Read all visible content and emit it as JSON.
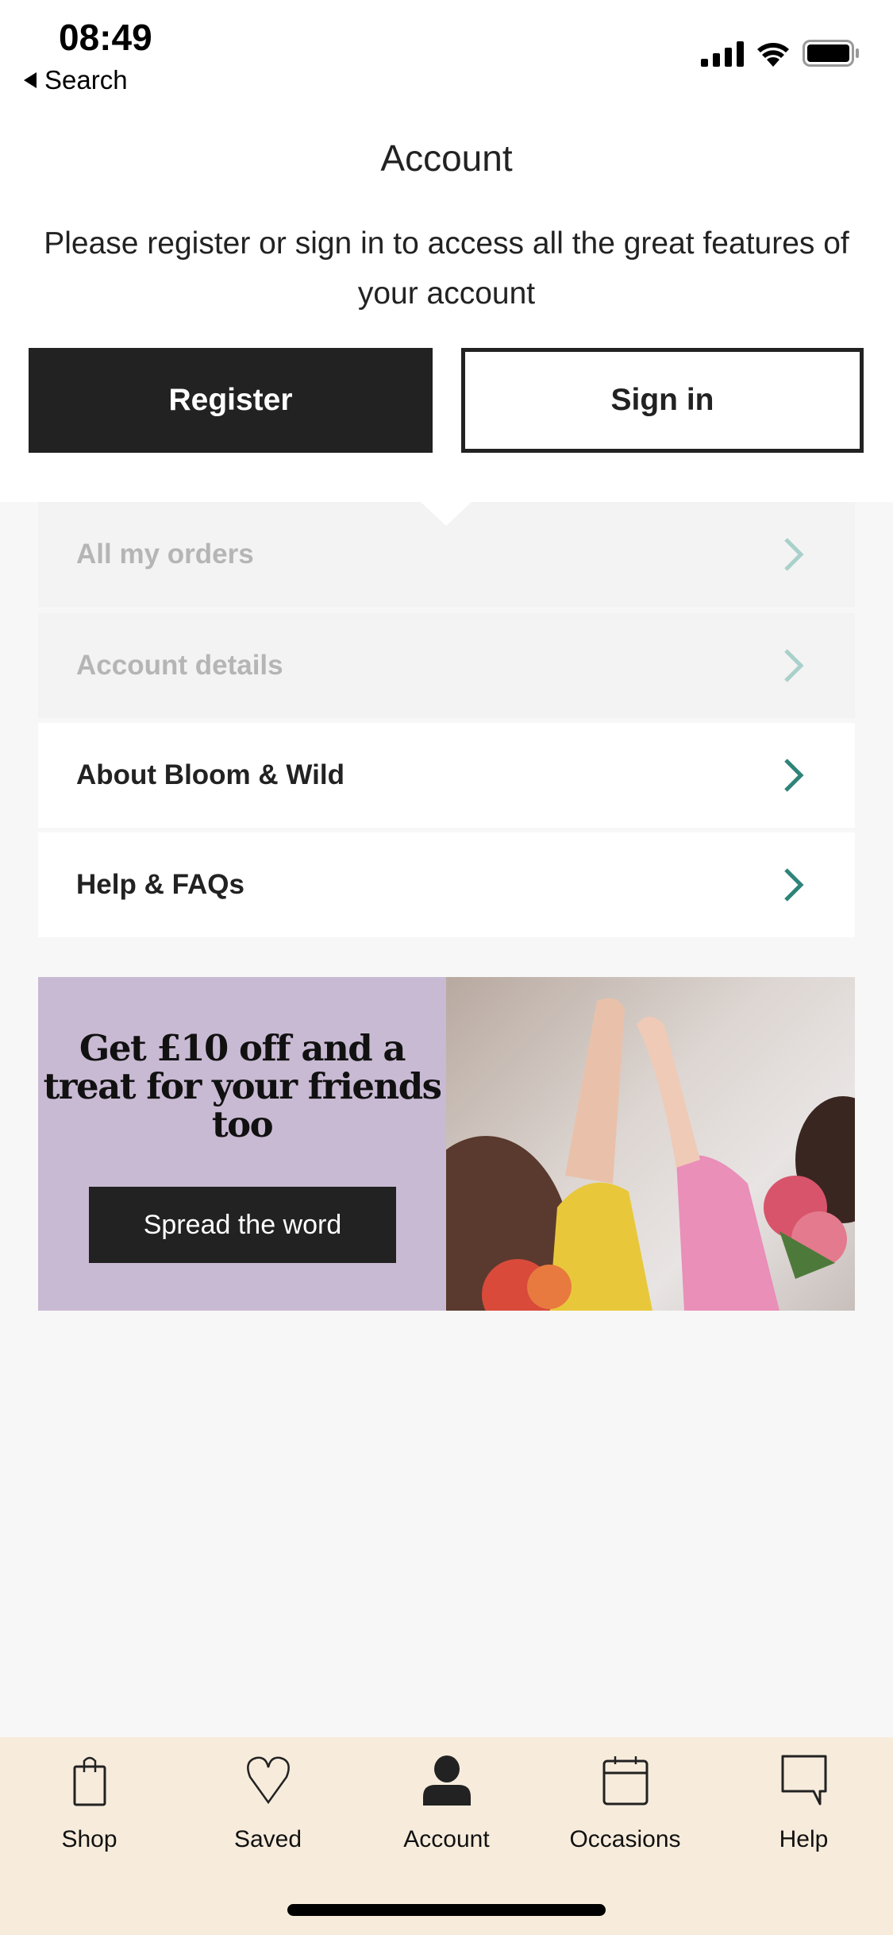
{
  "status_bar": {
    "time": "08:49",
    "back_label": "Search"
  },
  "header": {
    "title": "Account",
    "description": "Please register or sign in to access all the great features of your account",
    "register_label": "Register",
    "signin_label": "Sign in"
  },
  "menu": [
    {
      "label": "All my orders",
      "enabled": false
    },
    {
      "label": "Account details",
      "enabled": false
    },
    {
      "label": "About Bloom & Wild",
      "enabled": true
    },
    {
      "label": "Help & FAQs",
      "enabled": true
    }
  ],
  "promo": {
    "headline": "Get £10 off and a treat for your friends too",
    "button_label": "Spread the word",
    "bg_color": "#c9bad3"
  },
  "tabbar": {
    "items": [
      {
        "label": "Shop",
        "icon": "shopping-bag-icon"
      },
      {
        "label": "Saved",
        "icon": "heart-icon"
      },
      {
        "label": "Account",
        "icon": "person-icon",
        "active": true
      },
      {
        "label": "Occasions",
        "icon": "calendar-icon"
      },
      {
        "label": "Help",
        "icon": "chat-bubble-icon"
      }
    ]
  },
  "colors": {
    "accent": "#2e8479",
    "accent_disabled": "#a9d0ca",
    "dark": "#222222",
    "tabbar_bg": "#f7ecdc"
  }
}
